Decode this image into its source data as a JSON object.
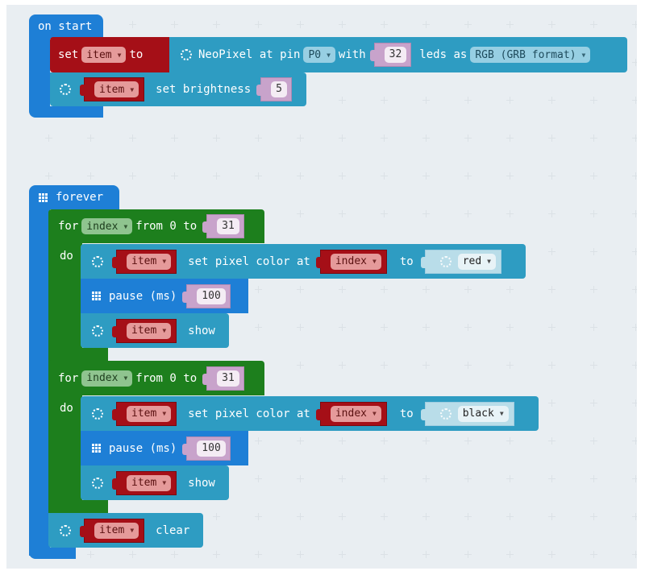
{
  "workspace": {
    "on_start": {
      "label": "on start",
      "set_block": {
        "set": "set",
        "variable": "item",
        "to": "to"
      },
      "neopixel_create": {
        "text1": "NeoPixel at pin",
        "pin": "P0",
        "with": "with",
        "count": "32",
        "leds_as": "leds as",
        "mode": "RGB (GRB format)"
      },
      "brightness_block": {
        "variable": "item",
        "text": "set brightness",
        "value": "5"
      }
    },
    "forever": {
      "label": "forever",
      "loops": [
        {
          "for": "for",
          "variable": "index",
          "from_to": "from 0 to",
          "end": "31",
          "do": "do",
          "set_pixel": {
            "variable": "item",
            "text": "set pixel color at",
            "index": "index",
            "to": "to",
            "color": "red"
          },
          "pause": {
            "text": "pause (ms)",
            "value": "100"
          },
          "show": {
            "variable": "item",
            "text": "show"
          }
        },
        {
          "for": "for",
          "variable": "index",
          "from_to": "from 0 to",
          "end": "31",
          "do": "do",
          "set_pixel": {
            "variable": "item",
            "text": "set pixel color at",
            "index": "index",
            "to": "to",
            "color": "black"
          },
          "pause": {
            "text": "pause (ms)",
            "value": "100"
          },
          "show": {
            "variable": "item",
            "text": "show"
          }
        }
      ],
      "clear": {
        "variable": "item",
        "text": "clear"
      }
    }
  },
  "icons": {
    "neopixel": "neopixel-dotted-circle-icon",
    "basic": "grid-icon",
    "dropdown": "dropdown-arrow-icon"
  },
  "colors": {
    "canvas": "#e9eef2",
    "basic_blue": "#1e7fd6",
    "variables_red": "#a50f17",
    "neopixel_teal": "#2e9cc2",
    "loops_green": "#1d7f1d",
    "math_purple": "#c8a3cb"
  }
}
